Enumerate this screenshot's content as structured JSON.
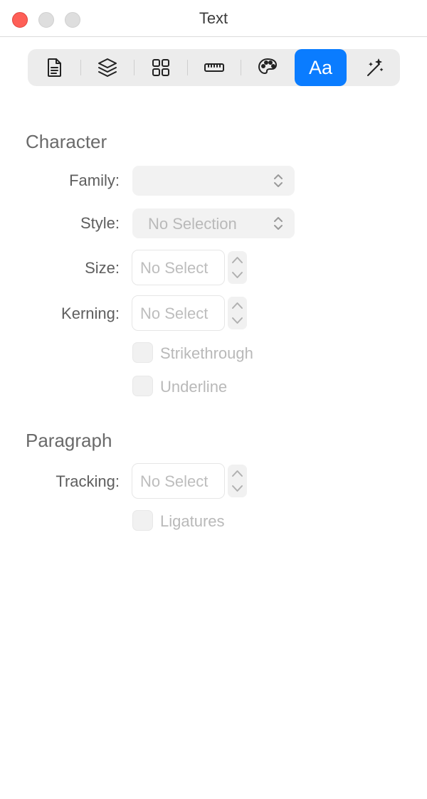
{
  "window": {
    "title": "Text"
  },
  "toolbar": {
    "tabs": [
      {
        "name": "document",
        "icon": "document-icon"
      },
      {
        "name": "layers",
        "icon": "layers-icon"
      },
      {
        "name": "grid",
        "icon": "grid-icon"
      },
      {
        "name": "ruler",
        "icon": "ruler-icon"
      },
      {
        "name": "palette",
        "icon": "palette-icon"
      },
      {
        "name": "text",
        "label": "Aa",
        "active": true
      },
      {
        "name": "effects",
        "icon": "magic-wand-icon"
      }
    ],
    "accent_color": "#0a7cff"
  },
  "character": {
    "title": "Character",
    "family": {
      "label": "Family:",
      "value": ""
    },
    "style": {
      "label": "Style:",
      "value": "No Selection"
    },
    "size": {
      "label": "Size:",
      "value": "No Select"
    },
    "kerning": {
      "label": "Kerning:",
      "value": "No Select"
    },
    "strikethrough": {
      "label": "Strikethrough",
      "checked": false
    },
    "underline": {
      "label": "Underline",
      "checked": false
    }
  },
  "paragraph": {
    "title": "Paragraph",
    "tracking": {
      "label": "Tracking:",
      "value": "No Select"
    },
    "ligatures": {
      "label": "Ligatures",
      "checked": false
    }
  }
}
